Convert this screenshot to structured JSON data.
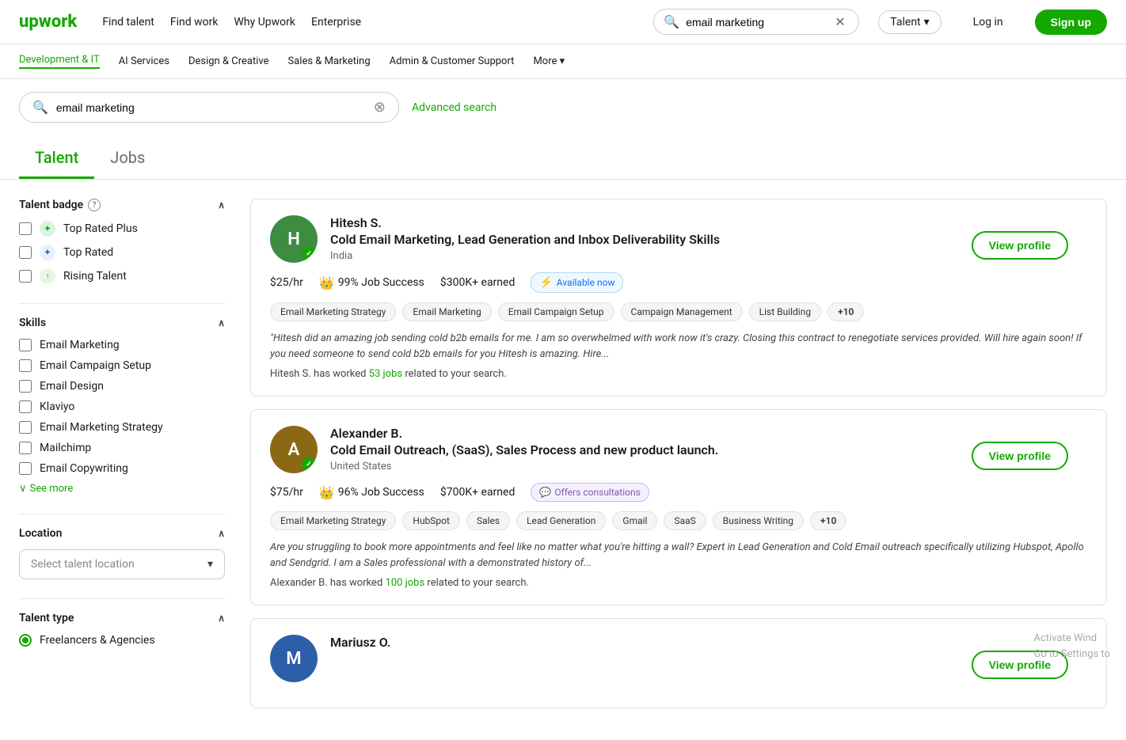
{
  "brand": {
    "logo": "upwork",
    "logo_color": "#14a800"
  },
  "top_nav": {
    "find_talent": "Find talent",
    "find_work": "Find work",
    "why_upwork": "Why Upwork",
    "enterprise": "Enterprise",
    "search_value": "email marketing",
    "search_placeholder": "email marketing",
    "talent_dropdown": "Talent",
    "login": "Log in",
    "signup": "Sign up"
  },
  "cat_nav": {
    "items": [
      {
        "label": "Development & IT",
        "active": false
      },
      {
        "label": "AI Services",
        "active": false
      },
      {
        "label": "Design & Creative",
        "active": false
      },
      {
        "label": "Sales & Marketing",
        "active": false
      },
      {
        "label": "Admin & Customer Support",
        "active": false
      },
      {
        "label": "More",
        "active": false
      }
    ]
  },
  "search_bar": {
    "value": "email marketing",
    "placeholder": "email marketing",
    "advanced_link": "Advanced search"
  },
  "tabs": {
    "talent": "Talent",
    "jobs": "Jobs",
    "active": "talent"
  },
  "sidebar": {
    "talent_badge": {
      "title": "Talent badge",
      "items": [
        {
          "label": "Top Rated Plus",
          "badge_type": "top-rated-plus"
        },
        {
          "label": "Top Rated",
          "badge_type": "top-rated"
        },
        {
          "label": "Rising Talent",
          "badge_type": "rising"
        }
      ]
    },
    "skills": {
      "title": "Skills",
      "items": [
        "Email Marketing",
        "Email Campaign Setup",
        "Email Design",
        "Klaviyo",
        "Email Marketing Strategy",
        "Mailchimp",
        "Email Copywriting"
      ],
      "see_more": "See more"
    },
    "location": {
      "title": "Location",
      "placeholder": "Select talent location"
    },
    "talent_type": {
      "title": "Talent type",
      "items": [
        {
          "label": "Freelancers & Agencies",
          "selected": true
        }
      ]
    }
  },
  "results": [
    {
      "name": "Hitesh S.",
      "title": "Cold Email Marketing, Lead Generation and Inbox Deliverability Skills",
      "location": "India",
      "rate": "$25/hr",
      "job_success": "99% Job Success",
      "earned": "$300K+ earned",
      "availability": "Available now",
      "availability_type": "available",
      "tags": [
        "Email Marketing Strategy",
        "Email Marketing",
        "Email Campaign Setup",
        "Campaign Management",
        "List Building",
        "+10"
      ],
      "review": "\"Hitesh did an amazing job sending cold b2b emails for me. I am so overwhelmed with work now it's crazy. Closing this contract to renegotiate services provided. Will hire again soon! If you need someone to send cold b2b emails for you Hitesh is amazing. Hire...",
      "jobs_worked_text": "Hitesh S. has worked ",
      "jobs_count": "53 jobs",
      "jobs_suffix": " related to your search.",
      "view_profile": "View profile",
      "avatar_initials": "H",
      "avatar_color": "avatar-green"
    },
    {
      "name": "Alexander B.",
      "title": "Cold Email Outreach, (SaaS), Sales Process and new product launch.",
      "location": "United States",
      "rate": "$75/hr",
      "job_success": "96% Job Success",
      "earned": "$700K+ earned",
      "availability": "Offers consultations",
      "availability_type": "consult",
      "tags": [
        "Email Marketing Strategy",
        "HubSpot",
        "Sales",
        "Lead Generation",
        "Gmail",
        "SaaS",
        "Business Writing",
        "+10"
      ],
      "review": "Are you struggling to book more appointments and feel like no matter what you're hitting a wall? Expert in Lead Generation and Cold Email outreach specifically utilizing Hubspot, Apollo and Sendgrid. I am a Sales professional with a demonstrated history of...",
      "jobs_worked_text": "Alexander B. has worked ",
      "jobs_count": "100 jobs",
      "jobs_suffix": " related to your search.",
      "view_profile": "View profile",
      "avatar_initials": "A",
      "avatar_color": "avatar-brown"
    },
    {
      "name": "Mariusz O.",
      "title": "",
      "location": "",
      "rate": "",
      "job_success": "",
      "earned": "",
      "availability": "",
      "availability_type": "",
      "tags": [],
      "review": "",
      "jobs_worked_text": "",
      "jobs_count": "",
      "jobs_suffix": "",
      "view_profile": "View profile",
      "avatar_initials": "M",
      "avatar_color": "avatar-blue"
    }
  ],
  "windows_watermark": {
    "line1": "Activate Wind",
    "line2": "Go to Settings to"
  }
}
